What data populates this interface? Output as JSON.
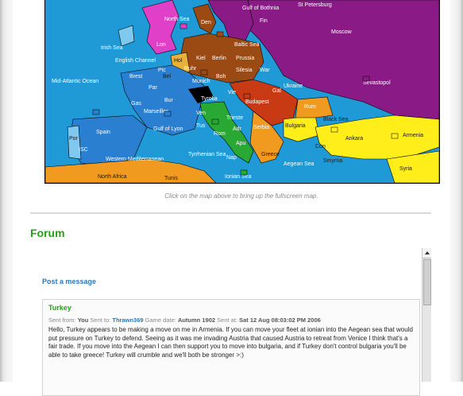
{
  "map": {
    "caption": "Click on the map above to bring up the fullscreen map.",
    "labels": {
      "st_petersburg": "St Petersburg",
      "gulf_of_bothnia": "Gulf of Bothnia",
      "north_sea": "North Sea",
      "den": "Den",
      "moscow": "Moscow",
      "irish_sea": "Irish Sea",
      "baltic_sea": "Baltic Sea",
      "lon": "Lon",
      "hol": "Hol",
      "kiel": "Kiel",
      "berlin": "Berlin",
      "prussia": "Prussia",
      "war": "War",
      "english_channel": "English Channel",
      "ruhr": "Ruhr",
      "bel": "Bel",
      "munich": "Munich",
      "boh": "Boh",
      "silesia": "Silesia",
      "ukraine": "Ukraine",
      "sevastopol": "Sevastopol",
      "mid_atlantic": "Mid-Atlantic Ocean",
      "brest": "Brest",
      "pic": "Pic",
      "par": "Par",
      "tyrolia": "Tyrolia",
      "vie": "Vie",
      "budapest": "Budapest",
      "gas": "Gas",
      "bur": "Bur",
      "gal": "Gal",
      "marseilles": "Marseilles",
      "ven": "Ven",
      "trieste": "Trieste",
      "black_sea": "Black Sea",
      "spain": "Spain",
      "gulf_of_lyon": "Gulf of Lyon",
      "tus": "Tus",
      "rom": "Rom",
      "serbia": "Serbia",
      "bulgaria": "Bulgaria",
      "rumania": "Rum",
      "armenia": "Armenia",
      "ankara": "Ankara",
      "con": "Con",
      "smyrna": "Smyrna",
      "apu": "Apu",
      "adr": "Adr",
      "gre": "Greece",
      "aegean": "Aegean Sea",
      "tyrrhenian": "Tyrrhenian Sea",
      "nap": "Nap",
      "western_med": "Western Mediterranean",
      "north_africa": "North Africa",
      "tunis": "Tunis",
      "ionian": "Ionian Sea",
      "syria": "Syria",
      "por": "Por",
      "iscl": "ISC",
      "fin": "Fin"
    }
  },
  "forum": {
    "heading": "Forum",
    "post_link": "Post a message",
    "message": {
      "country": "Turkey",
      "sent_from_label": "Sent from:",
      "sent_from": "You",
      "sent_to_label": "Sent to:",
      "sent_to": "Thrawn369",
      "game_date_label": "Game date:",
      "game_date": "Autumn 1902",
      "sent_at_label": "Sent at:",
      "sent_at": "Sat 12 Aug 08:03:02 PM 2006",
      "body": "Hello, Turkey appears to be making a move on me in Armenia. If you can move your fleet at ionian into the Aegean sea that would put pressure on Turkey to defend. Seeing as it was me invading Austria that caused Austria to retreat from Venice I think that's a fair trade. If you move into the Aegean I can then support you to move into bulgaria, and if Turkey don't control bulgaria you'll be able to take greece! Turkey will crumble and we'll both be stronger >:)"
    }
  },
  "colors": {
    "sea": "#1f9ad6",
    "russia": "#8a1a86",
    "germany": "#9a4a12",
    "england": "#e040c8",
    "france": "#2a7fd0",
    "austria": "#c83a14",
    "italy": "#29a834",
    "turkey": "#ffee1a",
    "neutral": "#f09a20",
    "forum_green": "#26a11a",
    "link_blue": "#2f77b8"
  }
}
